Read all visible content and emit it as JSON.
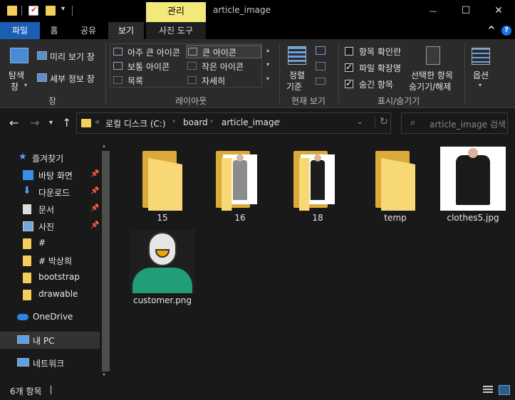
{
  "title_bar": {
    "context_tab": "관리",
    "window_title": "article_image",
    "minimize_glyph": "—",
    "maximize_glyph": "☐",
    "close_glyph": "✕"
  },
  "ribbon_tabs": {
    "file": "파일",
    "home": "홈",
    "share": "공유",
    "view": "보기",
    "picture_tools": "사진 도구",
    "collapse_glyph": "^",
    "help_glyph": "?"
  },
  "ribbon": {
    "nav_pane": "탐색",
    "nav_pane2": "창",
    "preview_pane": "미리 보기 창",
    "details_pane": "세부 정보 창",
    "group_panes": "창",
    "layout": {
      "extra_large": "아주 큰 아이콘",
      "large": "큰 아이콘",
      "medium": "보통 아이콘",
      "small": "작은 아이콘",
      "list": "목록",
      "details": "자세히"
    },
    "group_layout": "레이아웃",
    "sort": "정렬",
    "sort2": "기준",
    "group_current_view": "현재 보기",
    "item_checkboxes": "항목 확인란",
    "file_extensions": "파일 확장명",
    "hidden_items": "숨긴 항목",
    "hide_selected": "선택한 항목",
    "hide_selected2": "숨기기/해제",
    "group_show_hide": "표시/숨기기",
    "options": "옵션"
  },
  "address": {
    "prefix": "«",
    "crumbs": [
      "로컬 디스크 (C:)",
      "board",
      "article_image"
    ],
    "search_placeholder": "article_image 검색"
  },
  "nav": {
    "quick_access": "즐겨찾기",
    "items": [
      "바탕 화면",
      "다운로드",
      "문서",
      "사진",
      "#",
      "# 박상희",
      "bootstrap",
      "drawable"
    ],
    "onedrive": "OneDrive",
    "this_pc": "내 PC",
    "network": "네트워크"
  },
  "files": [
    {
      "name": "15",
      "type": "folder"
    },
    {
      "name": "16",
      "type": "folder-image"
    },
    {
      "name": "18",
      "type": "folder-image"
    },
    {
      "name": "temp",
      "type": "folder"
    },
    {
      "name": "clothes5.jpg",
      "type": "image"
    },
    {
      "name": "customer.png",
      "type": "image"
    }
  ],
  "status": {
    "count": "6개 항목"
  },
  "colors": {
    "accent": "#1a5fb4",
    "context_tab": "#f3e97b",
    "folder": "#f8d775",
    "avatar_green": "#1f9e77",
    "avatar_mouth": "#f0a500"
  }
}
